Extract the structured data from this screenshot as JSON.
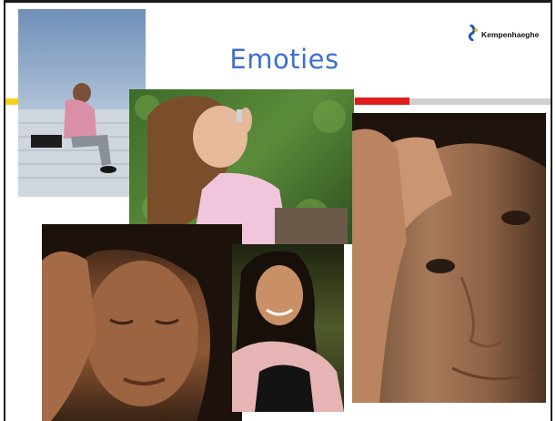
{
  "slide": {
    "title": "Emoties",
    "logo": {
      "text": "Kempenhaeghe",
      "icon": "kempenhaeghe-logo-icon"
    }
  },
  "colors": {
    "title": "#3d6fcf",
    "stripe_gray": "#d0d0d0",
    "stripe_yellow": "#f5d21a",
    "stripe_red": "#e01b1b"
  },
  "photos": [
    {
      "subject": "man sitting on steps with head in hands"
    },
    {
      "subject": "girl on phone sitting on grass"
    },
    {
      "subject": "man holding forehead, close-up"
    },
    {
      "subject": "woman holding head with eyes closed"
    },
    {
      "subject": "smiling young woman"
    }
  ]
}
